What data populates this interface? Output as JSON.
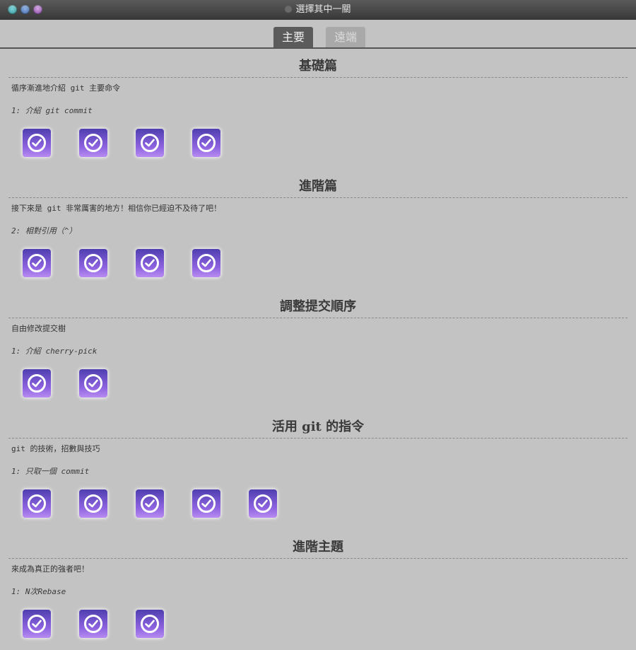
{
  "window": {
    "title": "選擇其中一關"
  },
  "tabs": [
    {
      "label": "主要",
      "active": true
    },
    {
      "label": "遠端",
      "active": false
    }
  ],
  "sections": [
    {
      "title": "基礎篇",
      "description": "循序漸進地介紹 git 主要命令",
      "level_name": "1: 介紹 git commit",
      "levels": [
        1,
        2,
        3,
        4
      ]
    },
    {
      "title": "進階篇",
      "description": "接下來是 git 非常厲害的地方！相信你已經迫不及待了吧！",
      "level_name": "2: 相對引用（^）",
      "levels": [
        1,
        2,
        3,
        4
      ]
    },
    {
      "title": "調整提交順序",
      "description": "自由修改提交樹",
      "level_name": "1: 介紹 cherry-pick",
      "levels": [
        1,
        2
      ]
    },
    {
      "title": "活用 git 的指令",
      "description": "git 的技術，招數與技巧",
      "level_name": "1: 只取一個 commit",
      "levels": [
        1,
        2,
        3,
        4,
        5
      ]
    },
    {
      "title": "進階主題",
      "description": "來成為真正的強者吧！",
      "level_name": "1: N次Rebase",
      "levels": [
        1,
        2,
        3
      ]
    }
  ],
  "icons": {
    "level": "check-circle-icon"
  },
  "colors": {
    "level_button_top": "#4f3fb0",
    "level_button_bottom": "#b88cf0",
    "background": "#c3c3c3"
  }
}
